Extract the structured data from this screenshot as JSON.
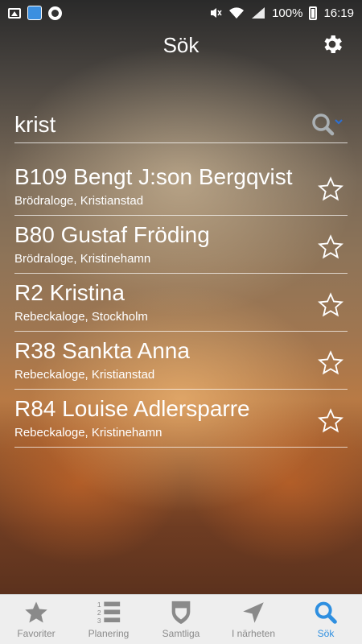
{
  "status_bar": {
    "battery": "100%",
    "time": "16:19",
    "icons": [
      "image-icon",
      "app-notification-icon",
      "round-app-icon",
      "mute-icon",
      "wifi-icon",
      "signal-icon",
      "battery-icon"
    ]
  },
  "header": {
    "title": "Sök",
    "settings_icon": "gear-icon"
  },
  "search": {
    "value": "krist",
    "icon": "search-icon"
  },
  "results": [
    {
      "title": "B109 Bengt J:son Bergqvist",
      "subtitle": "Brödraloge, Kristianstad"
    },
    {
      "title": "B80 Gustaf Fröding",
      "subtitle": "Brödraloge, Kristinehamn"
    },
    {
      "title": "R2 Kristina",
      "subtitle": "Rebeckaloge, Stockholm"
    },
    {
      "title": "R38 Sankta Anna",
      "subtitle": "Rebeckaloge, Kristianstad"
    },
    {
      "title": "R84 Louise Adlersparre",
      "subtitle": "Rebeckaloge, Kristinehamn"
    }
  ],
  "tabs": [
    {
      "label": "Favoriter",
      "icon": "star-icon"
    },
    {
      "label": "Planering",
      "icon": "numbered-list-icon"
    },
    {
      "label": "Samtliga",
      "icon": "shield-icon"
    },
    {
      "label": "I närheten",
      "icon": "location-arrow-icon"
    },
    {
      "label": "Sök",
      "icon": "search-icon",
      "active": true
    }
  ],
  "colors": {
    "accent": "#2e8fe0",
    "tab_inactive": "#8a8a8a",
    "tabbar_bg": "#eeeeee"
  }
}
